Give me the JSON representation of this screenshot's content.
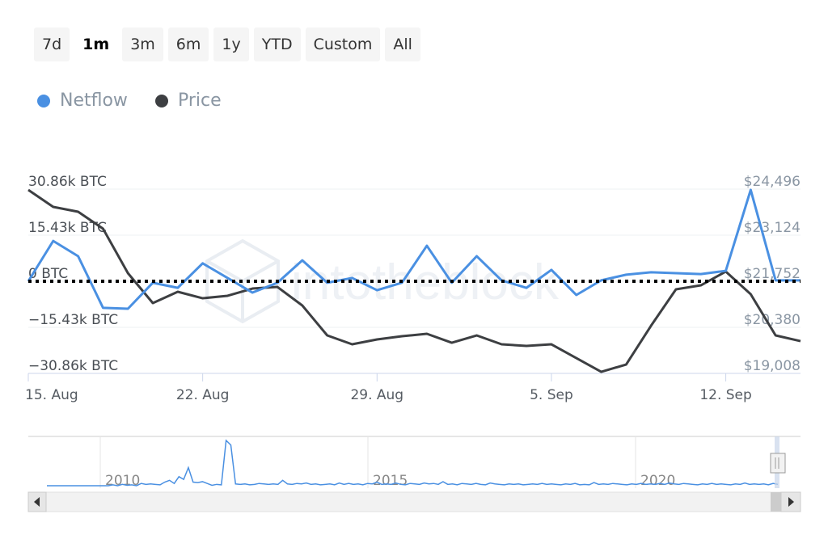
{
  "range_selector": {
    "buttons": [
      "7d",
      "1m",
      "3m",
      "6m",
      "1y",
      "YTD",
      "Custom",
      "All"
    ],
    "active": "1m"
  },
  "colors": {
    "netflow": "#4a90e2",
    "price": "#3d3f42",
    "zero_line": "#000000",
    "axis_text": "#8a96a3",
    "left_axis_text": "#4a4f55"
  },
  "watermark": "intotheblock",
  "chart_data": {
    "type": "line",
    "title": "",
    "legend": {
      "position": "top-left",
      "entries": [
        "Netflow",
        "Price"
      ]
    },
    "x": [
      "15. Aug",
      "16. Aug",
      "17. Aug",
      "18. Aug",
      "19. Aug",
      "20. Aug",
      "21. Aug",
      "22. Aug",
      "23. Aug",
      "24. Aug",
      "25. Aug",
      "26. Aug",
      "27. Aug",
      "28. Aug",
      "29. Aug",
      "30. Aug",
      "31. Aug",
      "1. Sep",
      "2. Sep",
      "3. Sep",
      "4. Sep",
      "5. Sep",
      "6. Sep",
      "7. Sep",
      "8. Sep",
      "9. Sep",
      "10. Sep",
      "11. Sep",
      "12. Sep",
      "13. Sep",
      "14. Sep",
      "15. Sep"
    ],
    "x_tick_labels": [
      "15. Aug",
      "22. Aug",
      "29. Aug",
      "5. Sep",
      "12. Sep"
    ],
    "x_tick_indices": [
      0,
      7,
      14,
      21,
      28
    ],
    "series": [
      {
        "name": "Netflow",
        "axis": "left",
        "unit": "k BTC",
        "values": [
          0,
          13.5,
          8.4,
          -8.9,
          -9.2,
          -0.5,
          -2.2,
          6.0,
          1.1,
          -3.8,
          -0.5,
          7.0,
          -0.5,
          1.1,
          -3.0,
          -0.5,
          11.9,
          -0.5,
          8.4,
          0.3,
          -2.2,
          3.8,
          -4.6,
          0.3,
          2.2,
          3.0,
          2.7,
          2.4,
          3.5,
          30.6,
          0.3,
          0.3
        ]
      },
      {
        "name": "Price",
        "axis": "right",
        "unit": "USD",
        "values": [
          24472,
          23966,
          23822,
          23317,
          21993,
          21102,
          21439,
          21246,
          21319,
          21535,
          21583,
          21030,
          20139,
          19874,
          20019,
          20115,
          20187,
          19922,
          20139,
          19874,
          19826,
          19874,
          19465,
          19056,
          19272,
          20428,
          21511,
          21631,
          22041,
          21367,
          20139,
          19970
        ]
      }
    ],
    "left_axis": {
      "ticks": [
        30.86,
        15.43,
        0,
        -15.43,
        -30.86
      ],
      "tick_labels": [
        "30.86k BTC",
        "15.43k BTC",
        "0 BTC",
        "−15.43k BTC",
        "−30.86k BTC"
      ],
      "range": [
        -30.86,
        30.86
      ]
    },
    "right_axis": {
      "ticks": [
        24496,
        23124,
        21752,
        20380,
        19008
      ],
      "tick_labels": [
        "$24,496",
        "$23,124",
        "$21,752",
        "$20,380",
        "$19,008"
      ],
      "range": [
        19008,
        24496
      ]
    },
    "zero_line": {
      "value": 0,
      "style": "dotted"
    },
    "grid": true
  },
  "navigator": {
    "year_labels": [
      "2010",
      "2015",
      "2020"
    ],
    "series_name": "Netflow (all time)",
    "values": [
      0,
      0,
      0,
      0,
      0,
      0,
      0,
      0,
      0,
      0,
      0,
      0,
      0,
      0,
      0.02,
      0,
      0.03,
      0.01,
      0.02,
      0,
      0.05,
      0.03,
      0.04,
      0.03,
      0.02,
      0.08,
      0.12,
      0.05,
      0.2,
      0.14,
      0.4,
      0.08,
      0.07,
      0.09,
      0.05,
      0.01,
      0.03,
      0.02,
      1,
      0.9,
      0.04,
      0.03,
      0.04,
      0.02,
      0.03,
      0.05,
      0.04,
      0.03,
      0.04,
      0.03,
      0.12,
      0.04,
      0.03,
      0.05,
      0.04,
      0.06,
      0.03,
      0.04,
      0.02,
      0.03,
      0.04,
      0.02,
      0.06,
      0.03,
      0.05,
      0.03,
      0.04,
      0.02,
      0.05,
      0.04,
      0.08,
      0.03,
      0.04,
      0.03,
      0.06,
      0.03,
      0.02,
      0.05,
      0.04,
      0.03,
      0.06,
      0.04,
      0.05,
      0.03,
      0.09,
      0.03,
      0.04,
      0.02,
      0.05,
      0.04,
      0.03,
      0.05,
      0.03,
      0.02,
      0.06,
      0.04,
      0.03,
      0.02,
      0.04,
      0.03,
      0.04,
      0.02,
      0.03,
      0.04,
      0.03,
      0.05,
      0.03,
      0.04,
      0.03,
      0.02,
      0.04,
      0.03,
      0.05,
      0.02,
      0.03,
      0.02,
      0.07,
      0.03,
      0.04,
      0.03,
      0.05,
      0.04,
      0.03,
      0.02,
      0.04,
      0.03,
      0.05,
      0.03,
      0.04,
      0.03,
      0.05,
      0.03,
      0.06,
      0.04,
      0.03,
      0.05,
      0.04,
      0.03,
      0.02,
      0.04,
      0.03,
      0.05,
      0.03,
      0.04,
      0.03,
      0.02,
      0.04,
      0.03,
      0.06,
      0.03,
      0.04,
      0.03,
      0.04,
      0.02,
      0.05,
      0.03
    ]
  }
}
